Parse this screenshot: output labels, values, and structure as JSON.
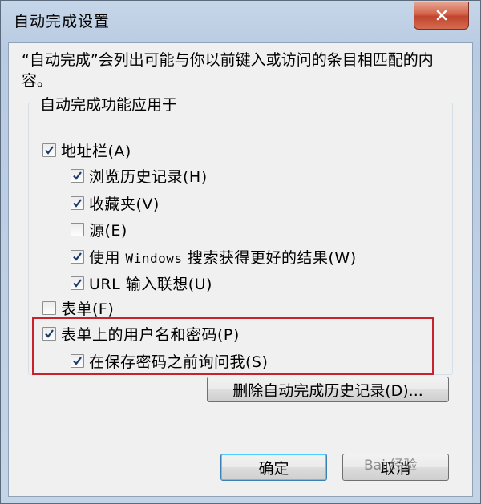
{
  "window": {
    "title": "自动完成设置",
    "close_icon": "close-icon"
  },
  "description": "“自动完成”会列出可能与你以前键入或访问的条目相匹配的内容。",
  "group": {
    "legend": "自动完成功能应用于",
    "options": [
      {
        "label": "地址栏(A)",
        "checked": true
      },
      {
        "label": "浏览历史记录(H)",
        "checked": true
      },
      {
        "label": "收藏夹(V)",
        "checked": true
      },
      {
        "label": "源(E)",
        "checked": false
      },
      {
        "label": "使用 Windows 搜索获得更好的结果(W)",
        "checked": true
      },
      {
        "label": "URL 输入联想(U)",
        "checked": true
      },
      {
        "label": "表单(F)",
        "checked": false
      },
      {
        "label": "表单上的用户名和密码(P)",
        "checked": true
      },
      {
        "label": "在保存密码之前询问我(S)",
        "checked": true
      }
    ]
  },
  "buttons": {
    "delete_history": "删除自动完成历史记录(D)...",
    "ok": "确定",
    "cancel": "取消"
  },
  "watermark": "Bai 经验",
  "colors": {
    "highlight_border": "#c8232c",
    "close_button": "#c0452e",
    "check_mark": "#1b3a6b"
  }
}
